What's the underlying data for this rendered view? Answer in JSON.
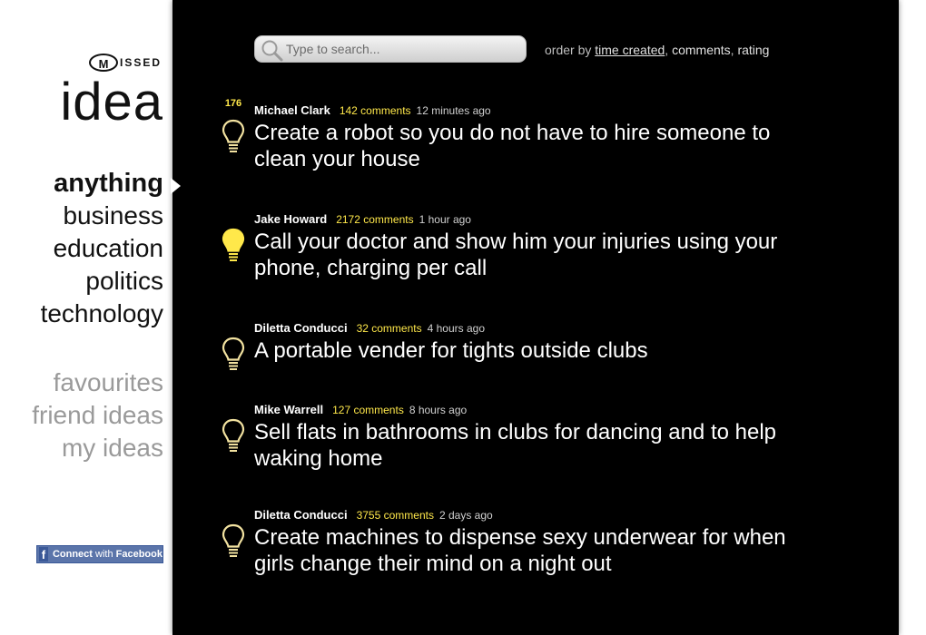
{
  "brand": {
    "badge_letter": "M",
    "badge_rest": "ISSED",
    "word": "idea"
  },
  "categories": [
    {
      "label": "anything",
      "active": true
    },
    {
      "label": "business"
    },
    {
      "label": "education"
    },
    {
      "label": "politics"
    },
    {
      "label": "technology"
    }
  ],
  "personal": [
    {
      "label": "favourites"
    },
    {
      "label": "friend ideas"
    },
    {
      "label": "my ideas"
    }
  ],
  "facebook": {
    "logo": "f",
    "connect": "Connect",
    "with": "with",
    "service": "Facebook"
  },
  "search": {
    "placeholder": "Type to search...",
    "icon": "magnifier-icon"
  },
  "order": {
    "prefix": "order by",
    "options": [
      "time created",
      "comments",
      "rating"
    ],
    "active": "time created"
  },
  "ideas": [
    {
      "votes": "176",
      "bulb": "off",
      "author": "Michael Clark",
      "comments": "142 comments",
      "time": "12 minutes ago",
      "text": "Create a robot so you do not have to hire someone to clean your house"
    },
    {
      "votes": "",
      "bulb": "on",
      "author": "Jake Howard",
      "comments": "2172 comments",
      "time": "1 hour ago",
      "text": "Call your doctor and show him your injuries using your phone, charging per call"
    },
    {
      "votes": "",
      "bulb": "off",
      "author": "Diletta Conducci",
      "comments": "32 comments",
      "time": "4 hours ago",
      "text": "A portable vender for tights outside clubs"
    },
    {
      "votes": "",
      "bulb": "off",
      "author": "Mike Warrell",
      "comments": "127 comments",
      "time": "8 hours ago",
      "text": "Sell flats in bathrooms in clubs for dancing and to help waking home"
    },
    {
      "votes": "",
      "bulb": "off",
      "author": "Diletta Conducci",
      "comments": "3755 comments",
      "time": "2 days ago",
      "text": "Create machines to dispense sexy underwear for when girls change their mind on a night out"
    }
  ],
  "colors": {
    "panel": "#000000",
    "accent_yellow": "#ffe84a",
    "bulb_outline": "#f2e2a0",
    "muted_nav": "#9a9a9a",
    "facebook_blue": "#3b5998"
  }
}
